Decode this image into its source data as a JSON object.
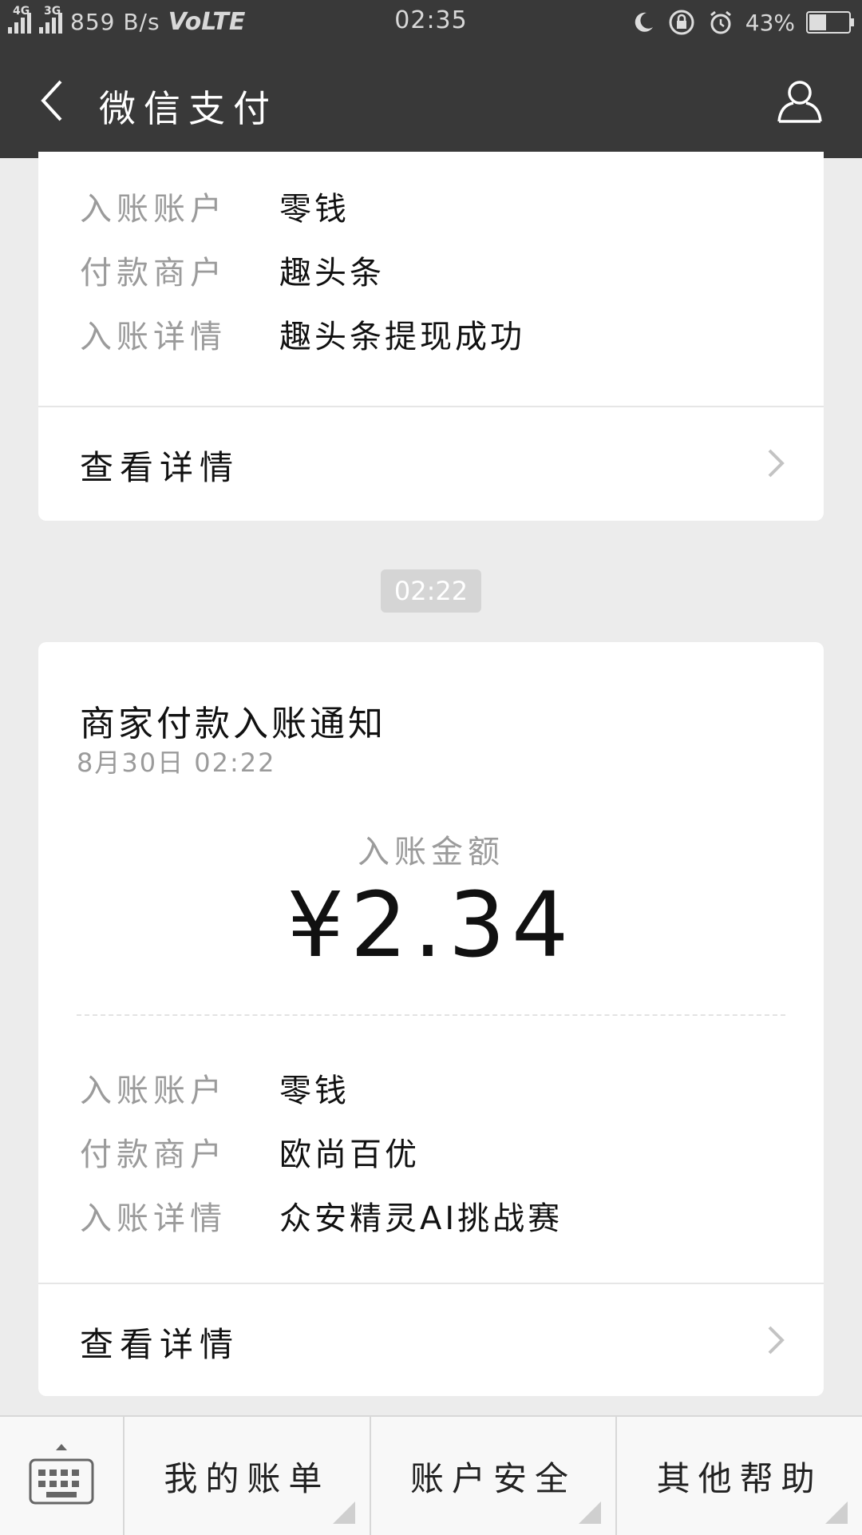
{
  "status_bar": {
    "net_4g": "4G",
    "net_3g": "3G",
    "speed": "859 B/s",
    "volte": "VoLTE",
    "time": "02:35",
    "battery": "43%",
    "battery_level": 0.43
  },
  "title_bar": {
    "title": "微信支付",
    "back_icon": "chevron-left-icon",
    "profile_icon": "user-icon"
  },
  "message_1": {
    "rows": [
      {
        "label": "入账账户",
        "value": "零钱"
      },
      {
        "label": "付款商户",
        "value": "趣头条"
      },
      {
        "label": "入账详情",
        "value": "趣头条提现成功"
      }
    ],
    "detail_link": "查看详情"
  },
  "timestamp_pill": "02:22",
  "message_2": {
    "title": "商家付款入账通知",
    "date": "8月30日  02:22",
    "amount_label": "入账金额",
    "amount": "¥2.34",
    "rows": [
      {
        "label": "入账账户",
        "value": "零钱"
      },
      {
        "label": "付款商户",
        "value": "欧尚百优"
      },
      {
        "label": "入账详情",
        "value": "众安精灵AI挑战赛"
      }
    ],
    "detail_link": "查看详情"
  },
  "bottom_bar": {
    "keyboard_icon": "keyboard-icon",
    "menus": [
      "我的账单",
      "账户安全",
      "其他帮助"
    ]
  },
  "colors": {
    "header_bg": "#393939",
    "page_bg": "#ececec",
    "card_bg": "#ffffff",
    "label_gray": "#9b9b9b"
  }
}
